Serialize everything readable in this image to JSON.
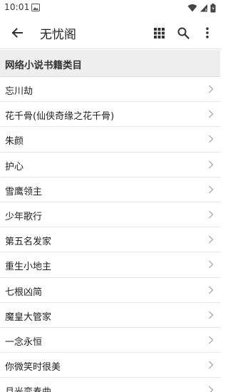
{
  "status_bar": {
    "time": "10:01",
    "icons": [
      "image-notification-icon",
      "wifi-icon",
      "signal-icon",
      "battery-icon"
    ]
  },
  "app_bar": {
    "title": "无忧阁",
    "actions": [
      "back-arrow-icon",
      "grid-icon",
      "search-icon",
      "more-vert-icon"
    ]
  },
  "section": {
    "title": "网络小说书籍类目"
  },
  "list": {
    "items": [
      {
        "label": "忘川劫"
      },
      {
        "label": "花千骨(仙侠奇缘之花千骨)"
      },
      {
        "label": "朱颜"
      },
      {
        "label": "护心"
      },
      {
        "label": "雪鹰领主"
      },
      {
        "label": "少年歌行"
      },
      {
        "label": "第五名发家"
      },
      {
        "label": "重生小地主"
      },
      {
        "label": "七根凶简"
      },
      {
        "label": "魔皇大管家"
      },
      {
        "label": "一念永恒"
      },
      {
        "label": "你微笑时很美"
      },
      {
        "label": "月光变奏曲"
      }
    ]
  },
  "colors": {
    "background": "#ffffff",
    "section_bg": "#eeeeee",
    "divider": "#e6e6e6",
    "text": "#222222",
    "chevron": "#9e9e9e"
  }
}
